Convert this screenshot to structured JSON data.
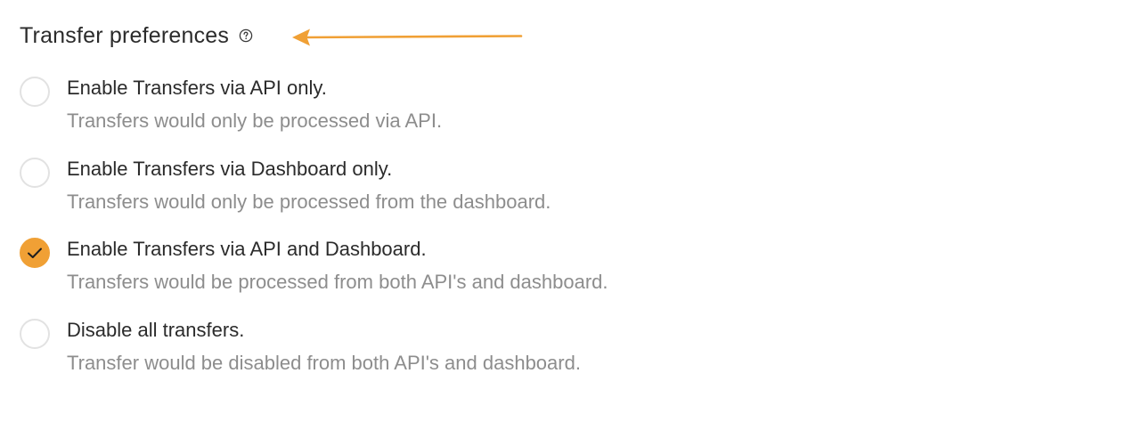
{
  "section": {
    "title": "Transfer preferences",
    "help_icon": "help-circle-icon",
    "annotation_icon": "arrow-left-icon"
  },
  "colors": {
    "accent": "#F0A035",
    "title_text": "#2B2B2B",
    "secondary_text": "#8D8D8D",
    "radio_border": "#E2E2E2"
  },
  "options": [
    {
      "label": "Enable Transfers via API only.",
      "description": "Transfers would only be processed via API.",
      "selected": false
    },
    {
      "label": "Enable Transfers via Dashboard only.",
      "description": "Transfers would only be processed from the dashboard.",
      "selected": false
    },
    {
      "label": "Enable Transfers via API and Dashboard.",
      "description": "Transfers would be processed from both API's and dashboard.",
      "selected": true
    },
    {
      "label": "Disable all transfers.",
      "description": "Transfer would be disabled from both API's and dashboard.",
      "selected": false
    }
  ]
}
